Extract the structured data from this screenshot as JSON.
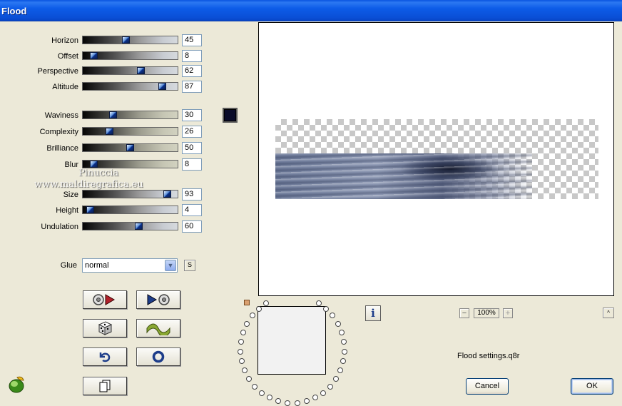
{
  "window": {
    "title": "Flood"
  },
  "sliders": [
    {
      "label": "Horizon",
      "value": "45",
      "fraction": 0.45
    },
    {
      "label": "Offset",
      "value": "8",
      "fraction": 0.08
    },
    {
      "label": "Perspective",
      "value": "62",
      "fraction": 0.62
    },
    {
      "label": "Altitude",
      "value": "87",
      "fraction": 0.87
    },
    {
      "label": "Waviness",
      "value": "30",
      "fraction": 0.3
    },
    {
      "label": "Complexity",
      "value": "26",
      "fraction": 0.26
    },
    {
      "label": "Brilliance",
      "value": "50",
      "fraction": 0.5
    },
    {
      "label": "Blur",
      "value": "8",
      "fraction": 0.08
    },
    {
      "label": "Size",
      "value": "93",
      "fraction": 0.93
    },
    {
      "label": "Height",
      "value": "4",
      "fraction": 0.04
    },
    {
      "label": "Undulation",
      "value": "60",
      "fraction": 0.6
    }
  ],
  "colors": {
    "water_color": "#0a0c2a",
    "titlebar": "#0a55e0"
  },
  "glue": {
    "label": "Glue",
    "value": "normal",
    "button_label": "S"
  },
  "tool_buttons": [
    {
      "icon": "disc-play-left-icon"
    },
    {
      "icon": "play-disc-right-icon"
    },
    {
      "icon": "dice-icon"
    },
    {
      "icon": "wave-icon"
    },
    {
      "icon": "undo-arrow-icon"
    },
    {
      "icon": "ring-icon"
    },
    {
      "icon": "copy-pages-icon"
    }
  ],
  "watermark": {
    "line1": "Pinuccia",
    "line2": "www.maldiregrafica.eu"
  },
  "zoom": {
    "value": "100%",
    "minus": "−",
    "plus": "+"
  },
  "info_button": {
    "label": "i"
  },
  "collapse_button": {
    "label": "^"
  },
  "settings_file": "Flood settings.q8r",
  "buttons": {
    "cancel": "Cancel",
    "ok": "OK"
  }
}
